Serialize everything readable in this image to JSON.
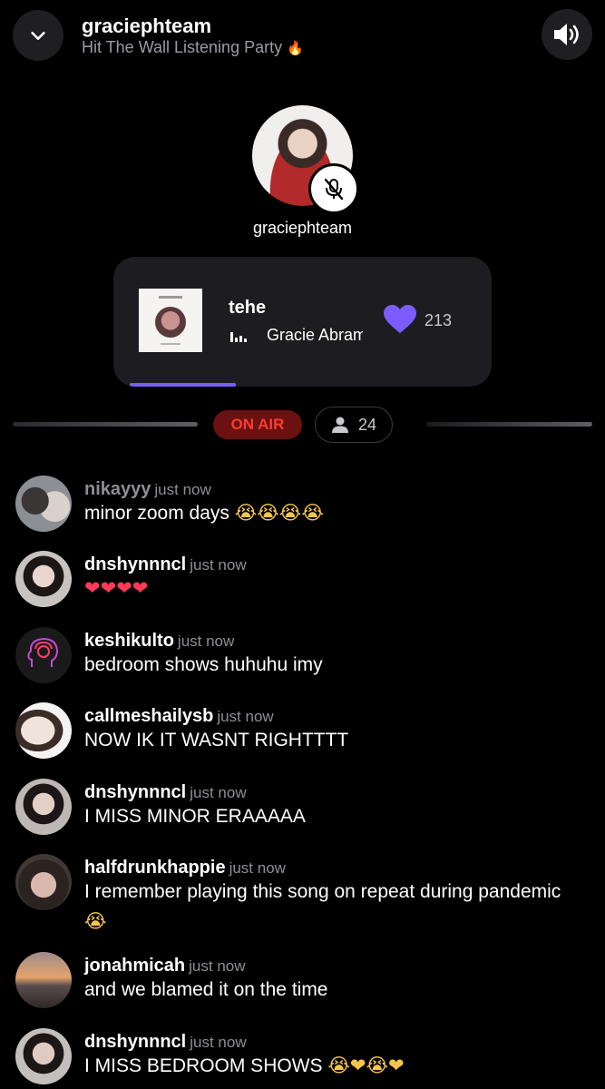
{
  "header": {
    "host_name": "graciephteam",
    "party_title": "Hit The Wall Listening Party",
    "party_emoji": "🔥",
    "back_icon": "chevron-down-icon",
    "sound_icon": "speaker-icon"
  },
  "host": {
    "name": "graciephteam",
    "muted": true
  },
  "now_playing": {
    "title": "tehe",
    "artist": "Gracie Abrams",
    "likes": "213",
    "progress": 0.28,
    "accent_color": "#7d5cff"
  },
  "status": {
    "on_air": "ON AIR",
    "listeners": "24"
  },
  "messages": [
    {
      "user": "nikayyy",
      "time": "just now",
      "text": "minor zoom days",
      "emoji": "😭😭😭😭"
    },
    {
      "user": "dnshynnncl",
      "time": "just now",
      "text": "",
      "emoji": "❤❤❤❤"
    },
    {
      "user": "keshikulto",
      "time": "just now",
      "text": "bedroom shows huhuhu imy",
      "emoji": ""
    },
    {
      "user": "callmeshailysb",
      "time": "just now",
      "text": "NOW IK IT WASNT RIGHTTTT",
      "emoji": ""
    },
    {
      "user": "dnshynnncl",
      "time": "just now",
      "text": "I MISS MINOR ERAAAAA",
      "emoji": ""
    },
    {
      "user": "halfdrunkhappie",
      "time": "just now",
      "text": "I remember playing this song on repeat during pandemic",
      "emoji": "😭"
    },
    {
      "user": "jonahmicah",
      "time": "just now",
      "text": "and we blamed it on the time",
      "emoji": ""
    },
    {
      "user": "dnshynnncl",
      "time": "just now",
      "text": "I MISS BEDROOM SHOWS",
      "emoji": "😭❤😭❤"
    }
  ]
}
